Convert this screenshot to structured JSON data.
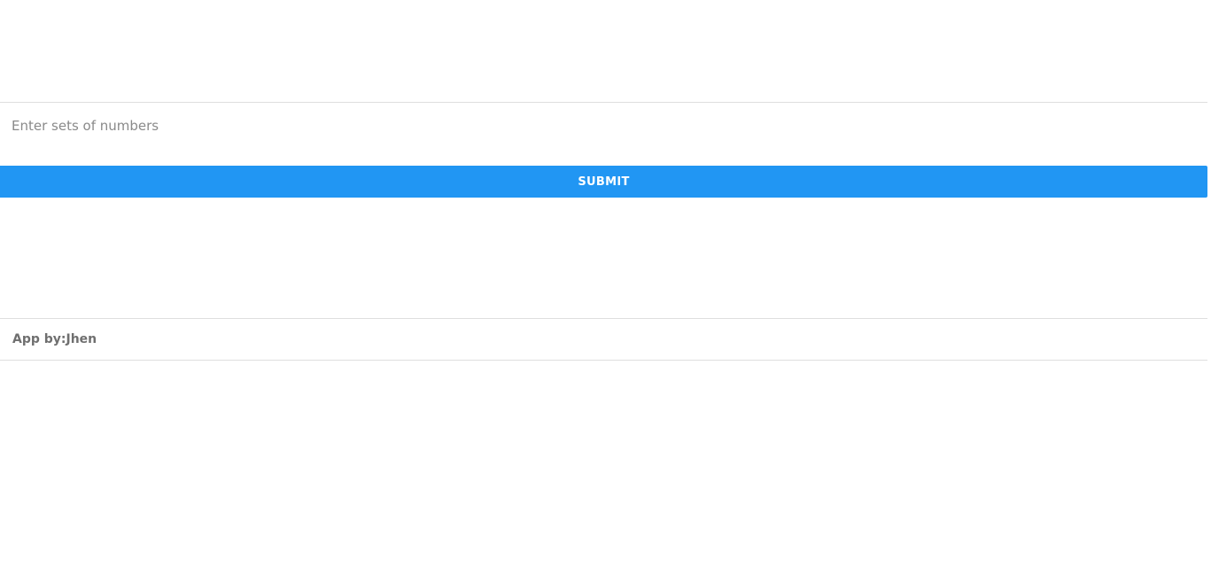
{
  "form": {
    "numbers_input": {
      "placeholder": "Enter sets of numbers",
      "value": ""
    },
    "submit_label": "SUBMIT"
  },
  "footer": {
    "credit": "App by:Jhen"
  },
  "colors": {
    "accent": "#2196f3",
    "divider": "#dedede",
    "muted_text": "#6f6f6f"
  }
}
